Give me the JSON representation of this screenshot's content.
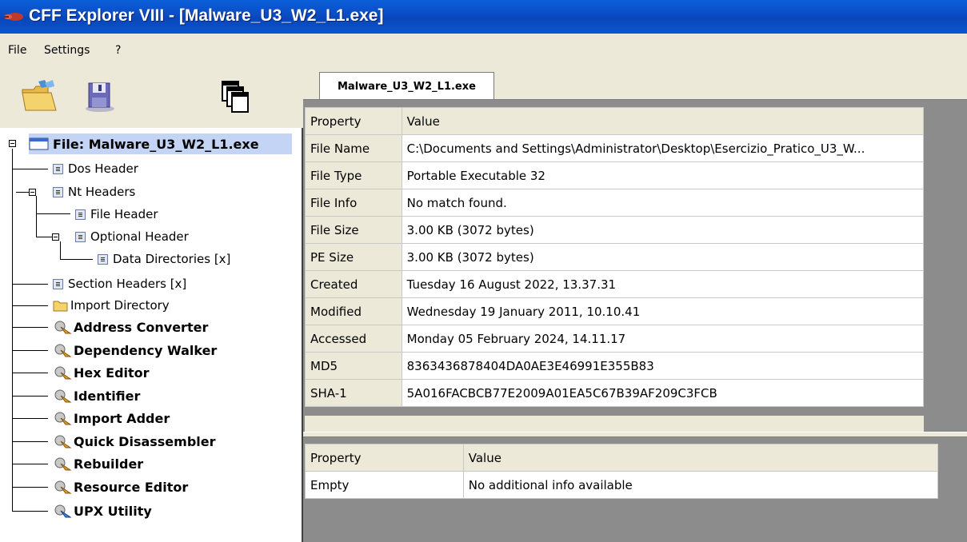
{
  "window": {
    "title": "CFF Explorer VIII - [Malware_U3_W2_L1.exe]"
  },
  "menu": [
    "File",
    "Settings",
    "?"
  ],
  "toolbar": {
    "buttons": [
      "open-folder-icon",
      "save-disk-icon",
      "windows-cascade-icon"
    ]
  },
  "tree": {
    "root": "File: Malware_U3_W2_L1.exe",
    "items": [
      {
        "label": "Dos Header"
      },
      {
        "label": "Nt Headers"
      },
      {
        "label": "File Header"
      },
      {
        "label": "Optional Header"
      },
      {
        "label": "Data Directories [x]"
      },
      {
        "label": "Section Headers [x]"
      },
      {
        "label": "Import Directory"
      },
      {
        "label": "Address Converter"
      },
      {
        "label": "Dependency Walker"
      },
      {
        "label": "Hex Editor"
      },
      {
        "label": "Identifier"
      },
      {
        "label": "Import Adder"
      },
      {
        "label": "Quick Disassembler"
      },
      {
        "label": "Rebuilder"
      },
      {
        "label": "Resource Editor"
      },
      {
        "label": "UPX Utility"
      }
    ]
  },
  "tab": {
    "label": "Malware_U3_W2_L1.exe"
  },
  "main_table": {
    "headers": [
      "Property",
      "Value"
    ],
    "rows": [
      [
        "File Name",
        "C:\\Documents and Settings\\Administrator\\Desktop\\Esercizio_Pratico_U3_W..."
      ],
      [
        "File Type",
        "Portable Executable 32"
      ],
      [
        "File Info",
        "No match found."
      ],
      [
        "File Size",
        "3.00 KB (3072 bytes)"
      ],
      [
        "PE Size",
        "3.00 KB (3072 bytes)"
      ],
      [
        "Created",
        "Tuesday 16 August 2022, 13.37.31"
      ],
      [
        "Modified",
        "Wednesday 19 January 2011, 10.10.41"
      ],
      [
        "Accessed",
        "Monday 05 February 2024, 14.11.17"
      ],
      [
        "MD5",
        "8363436878404DA0AE3E46991E355B83"
      ],
      [
        "SHA-1",
        "5A016FACBCB77E2009A01EA5C67B39AF209C3FCB"
      ]
    ]
  },
  "info_table": {
    "headers": [
      "Property",
      "Value"
    ],
    "rows": [
      [
        "Empty",
        "No additional info available"
      ]
    ]
  }
}
